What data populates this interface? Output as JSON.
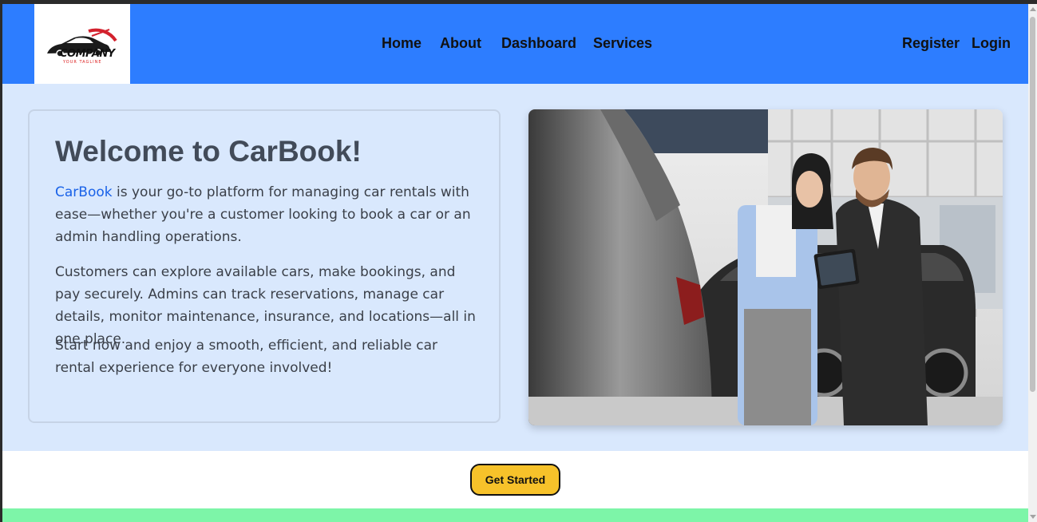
{
  "logo": {
    "company": "COMPANY",
    "tagline": "YOUR TAGLINE"
  },
  "nav": {
    "home": "Home",
    "about": "About",
    "dashboard": "Dashboard",
    "services": "Services",
    "register": "Register",
    "login": "Login"
  },
  "hero": {
    "title": "Welcome to CarBook!",
    "brand": "CarBook",
    "paragraph1_rest": " is your go-to platform for managing car rentals with ease—whether you're a customer looking to book a car or an admin handling operations.",
    "paragraph2": "Customers can explore available cars, make bookings, and pay securely. Admins can track reservations, manage car details, monitor maintenance, insurance, and locations—all in one place.",
    "paragraph3": "Start now and enjoy a smooth, efficient, and reliable car rental experience for everyone involved!"
  },
  "cta": {
    "label": "Get Started"
  },
  "colors": {
    "header": "#2d7dff",
    "hero_bg": "#d9e8fd",
    "brand_link": "#1a62e8",
    "cta_bg": "#f7c22a",
    "footer_band": "#7df5a8"
  }
}
